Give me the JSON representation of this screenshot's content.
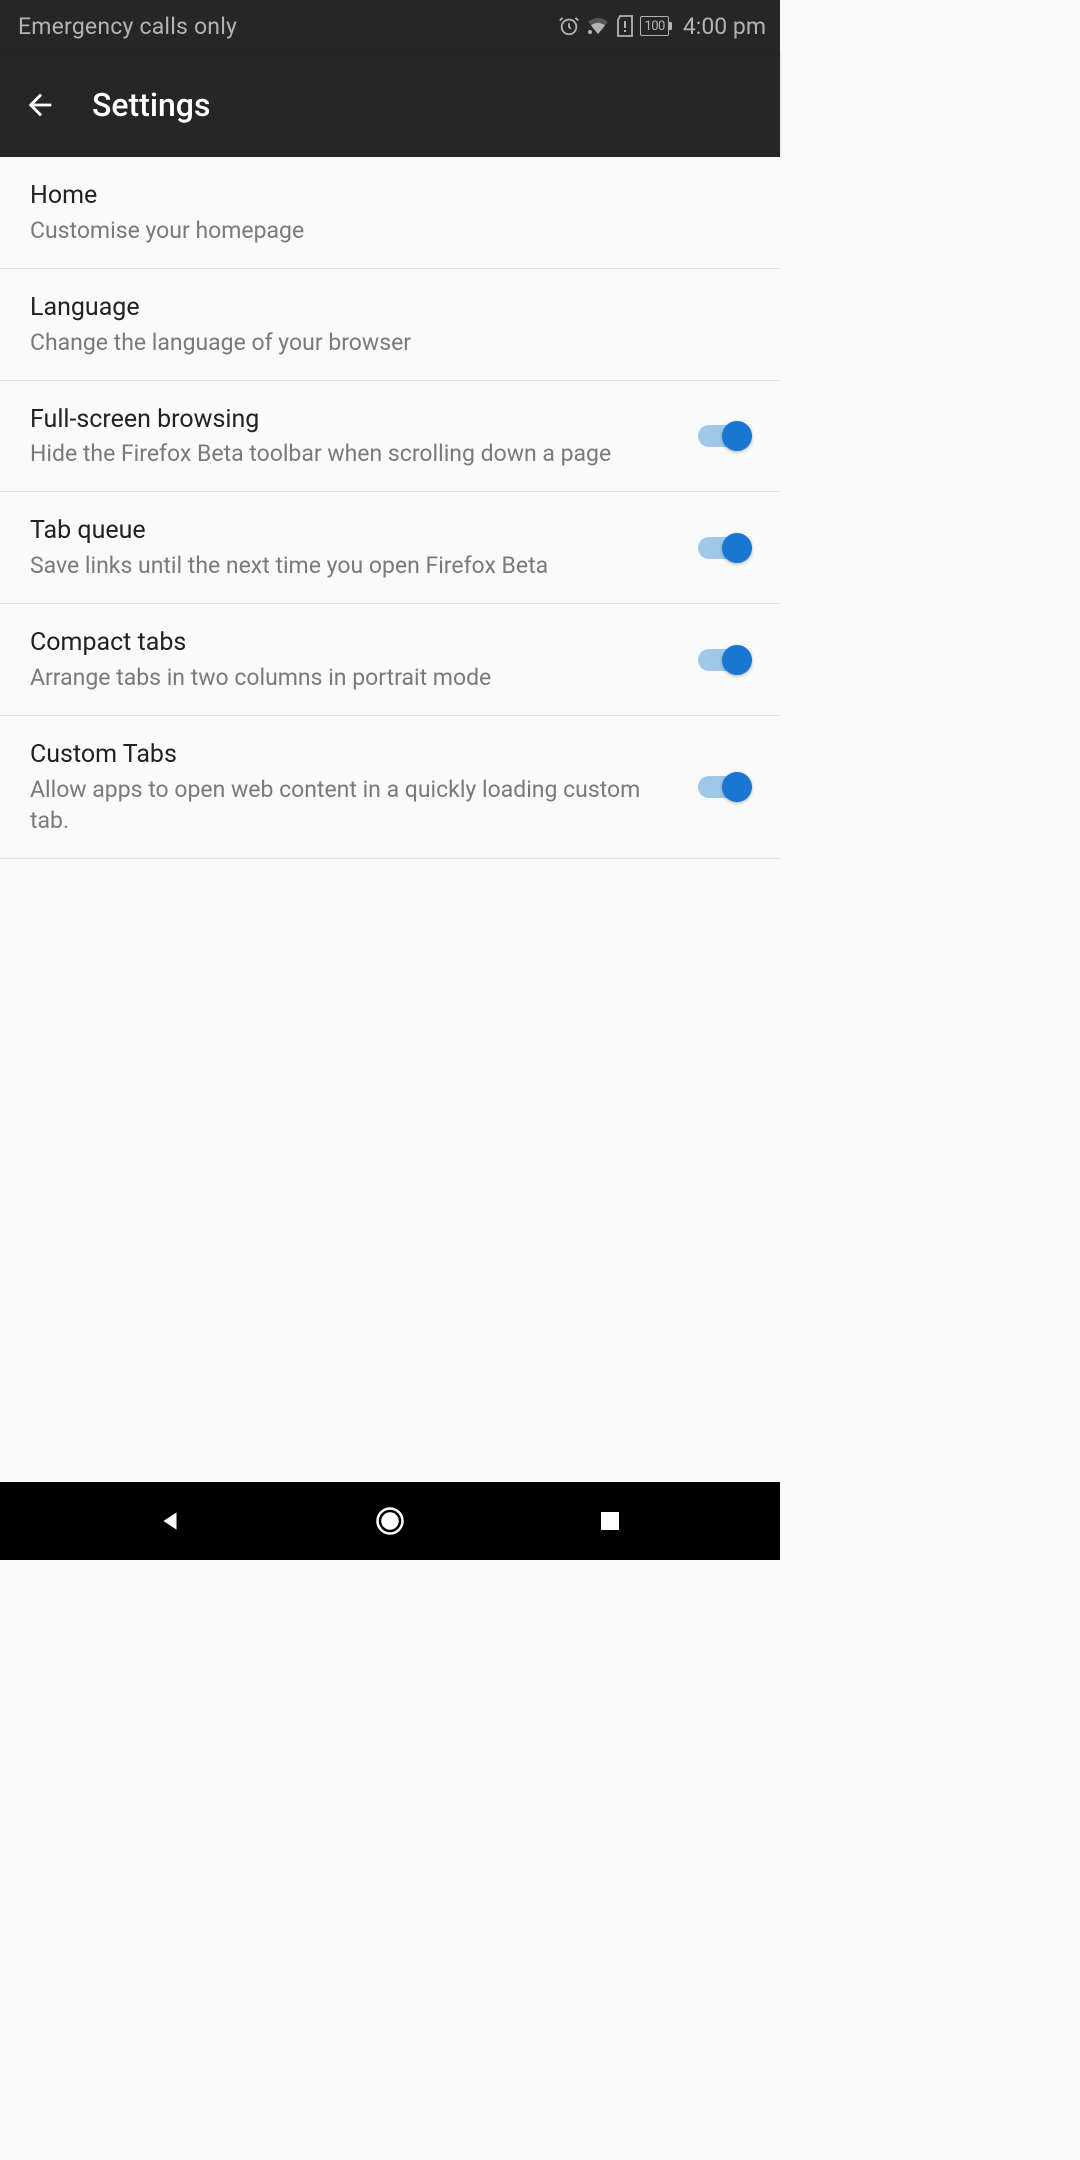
{
  "status_bar": {
    "carrier": "Emergency calls only",
    "battery": "100",
    "time": "4:00 pm"
  },
  "app_bar": {
    "title": "Settings"
  },
  "settings": [
    {
      "title": "Home",
      "summary": "Customise your homepage",
      "has_switch": false
    },
    {
      "title": "Language",
      "summary": "Change the language of your browser",
      "has_switch": false
    },
    {
      "title": "Full-screen browsing",
      "summary": "Hide the Firefox Beta toolbar when scrolling down a page",
      "has_switch": true,
      "switch_on": true
    },
    {
      "title": "Tab queue",
      "summary": "Save links until the next time you open Firefox Beta",
      "has_switch": true,
      "switch_on": true
    },
    {
      "title": "Compact tabs",
      "summary": "Arrange tabs in two columns in portrait mode",
      "has_switch": true,
      "switch_on": true
    },
    {
      "title": "Custom Tabs",
      "summary": "Allow apps to open web content in a quickly loading custom tab.",
      "has_switch": true,
      "switch_on": true
    }
  ]
}
